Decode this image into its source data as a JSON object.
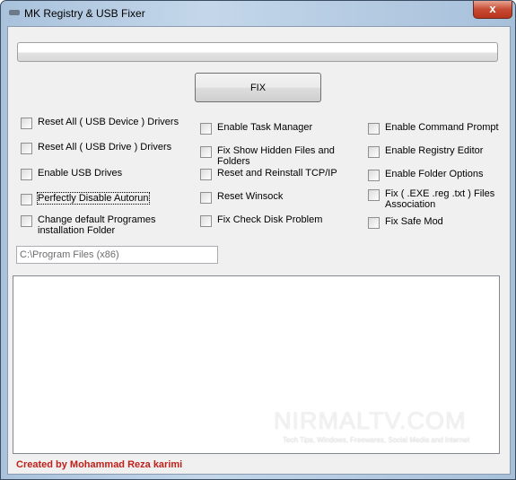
{
  "window": {
    "title": "MK Registry & USB Fixer",
    "close_glyph": "x"
  },
  "progress": {
    "value": 0
  },
  "fix_button": "FIX",
  "options": {
    "col1": [
      "Reset All ( USB Device ) Drivers",
      "Reset All ( USB Drive ) Drivers",
      "Enable USB Drives",
      "Perfectly Disable Autorun",
      "Change default Programes installation Folder"
    ],
    "col2": [
      "Enable Task Manager",
      "Fix Show Hidden Files and Folders",
      "Reset and Reinstall TCP/IP",
      "Reset Winsock",
      "Fix Check Disk Problem"
    ],
    "col3": [
      "Enable Command Prompt",
      "Enable Registry Editor",
      "Enable Folder Options",
      "Fix ( .EXE .reg .txt ) Files Association",
      "Fix Safe Mod"
    ]
  },
  "install_path": "C:\\Program Files (x86)",
  "watermark": {
    "title": "NIRMALTV.COM",
    "tagline": "Tech Tips, Windows, Freewares, Social Media and Internet"
  },
  "credit": "Created by Mohammad Reza karimi"
}
